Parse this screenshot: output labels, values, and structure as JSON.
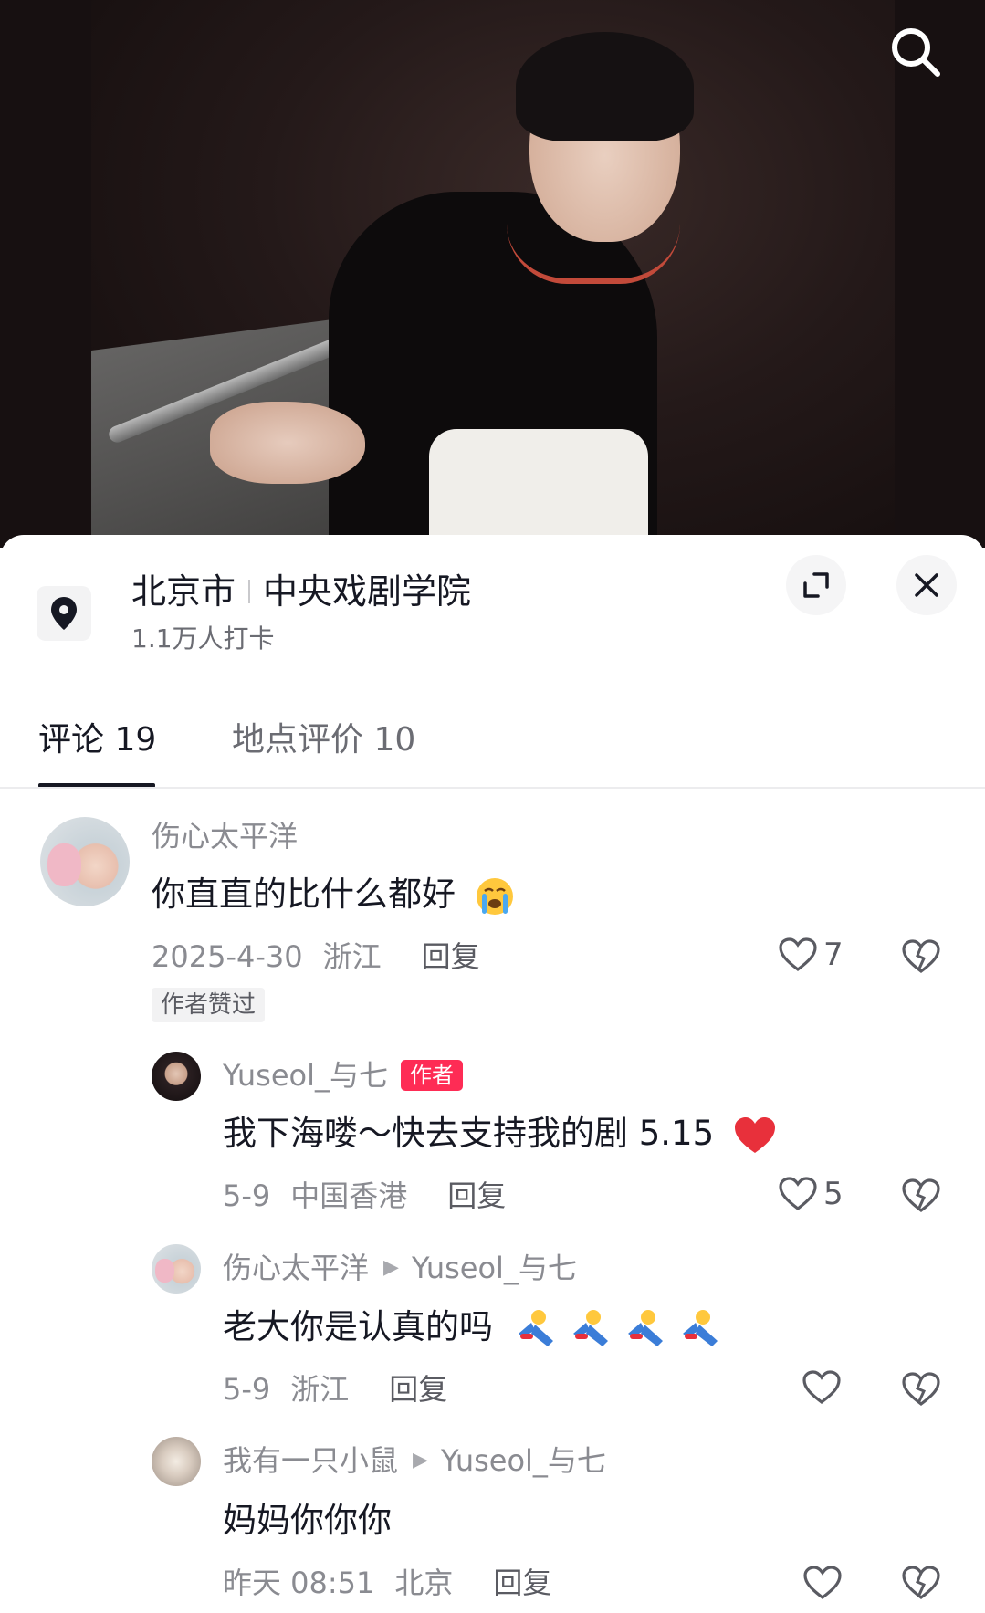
{
  "header": {
    "search_icon": "search-icon"
  },
  "location": {
    "city": "北京市",
    "place": "中央戏剧学院",
    "checkins": "1.1万人打卡",
    "pin_icon": "location-pin-icon",
    "expand_icon": "expand-icon",
    "close_icon": "close-icon"
  },
  "tabs": [
    {
      "label": "评论 19",
      "active": true
    },
    {
      "label": "地点评价 10",
      "active": false
    }
  ],
  "comments": [
    {
      "user": "伤心太平洋",
      "text": "你直直的比什么都好",
      "emoji": "crying-face",
      "date": "2025-4-30",
      "region": "浙江",
      "reply_label": "回复",
      "likes": "7",
      "badge": "作者赞过",
      "replies": [
        {
          "user": "Yuseol_与七",
          "author_badge": "作者",
          "text": "我下海喽～快去支持我的剧 5.15",
          "emoji": "red-heart",
          "date": "5-9",
          "region": "中国香港",
          "reply_label": "回复",
          "likes": "5"
        },
        {
          "user": "伤心太平洋",
          "reply_to": "Yuseol_与七",
          "text": "老大你是认真的吗",
          "emoji": "kneeling-figure x4",
          "date": "5-9",
          "region": "浙江",
          "reply_label": "回复",
          "likes": ""
        },
        {
          "user": "我有一只小鼠",
          "reply_to": "Yuseol_与七",
          "text": "妈妈你你你",
          "date": "昨天 08:51",
          "region": "北京",
          "reply_label": "回复",
          "likes": ""
        }
      ]
    }
  ],
  "colors": {
    "accent": "#fe2c55",
    "text": "#161823",
    "muted": "#8a8b91"
  }
}
